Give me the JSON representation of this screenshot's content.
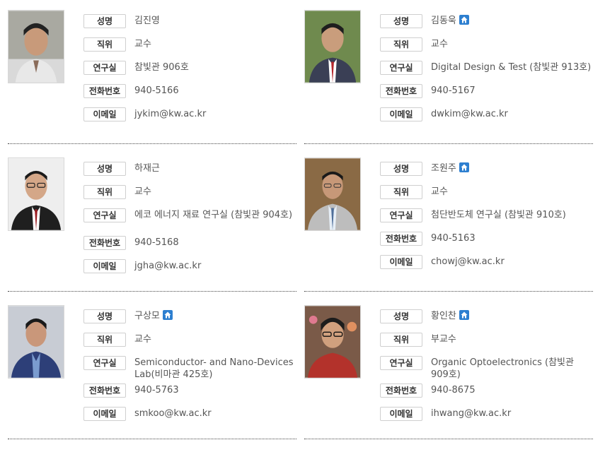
{
  "labels": {
    "name": "성명",
    "position": "직위",
    "lab": "연구실",
    "phone": "전화번호",
    "email": "이메일"
  },
  "accent_color": "#2d7fd0",
  "faculty": [
    {
      "name": "김진영",
      "position": "교수",
      "lab": "참빛관 906호",
      "phone": "940-5166",
      "email": "jykim@kw.ac.kr",
      "homepage_icon": false
    },
    {
      "name": "김동욱",
      "position": "교수",
      "lab": "Digital Design & Test (참빛관 913호)",
      "phone": "940-5167",
      "email": "dwkim@kw.ac.kr",
      "homepage_icon": true
    },
    {
      "name": "하재근",
      "position": "교수",
      "lab": "에코 에너지 재료 연구실 (참빛관 904호)",
      "phone": "940-5168",
      "email": "jgha@kw.ac.kr",
      "homepage_icon": false
    },
    {
      "name": "조원주",
      "position": "교수",
      "lab": "첨단반도체 연구실 (참빛관 910호)",
      "phone": "940-5163",
      "email": "chowj@kw.ac.kr",
      "homepage_icon": true
    },
    {
      "name": "구상모",
      "position": "교수",
      "lab": "Semiconductor- and Nano-Devices Lab(비마관 425호)",
      "phone": "940-5763",
      "email": "smkoo@kw.ac.kr",
      "homepage_icon": true
    },
    {
      "name": "황인찬",
      "position": "부교수",
      "lab": "Organic Optoelectronics (참빛관 909호)",
      "phone": "940-8675",
      "email": "ihwang@kw.ac.kr",
      "homepage_icon": true
    }
  ]
}
